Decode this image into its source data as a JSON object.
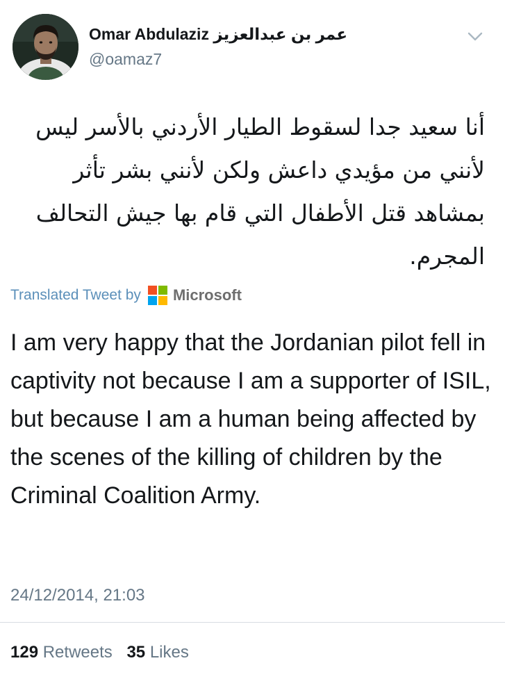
{
  "user": {
    "display_name": "Omar Abdulaziz عمر بن عبدالعزيز",
    "handle": "@oamaz7"
  },
  "icons": {
    "menu": "chevron-down-icon",
    "avatar": "profile-avatar",
    "translator_logo": "microsoft-logo"
  },
  "tweet": {
    "arabic_text": "أنا سعيد جدا لسقوط الطيار الأردني بالأسر ليس لأنني من مؤيدي داعش ولكن لأنني بشر تأثر بمشاهد قتل الأطفال التي قام بها جيش التحالف المجرم.",
    "translated_by_label": "Translated Tweet by",
    "translator_name": "Microsoft",
    "translation": "I am very happy that the Jordanian pilot fell in captivity not because I am a supporter of ISIL, but because I am a human being affected by the scenes of the killing of children by the Criminal Coalition Army.",
    "timestamp": "24/12/2014, 21:03"
  },
  "stats": {
    "retweets_count": "129",
    "retweets_label": "Retweets",
    "likes_count": "35",
    "likes_label": "Likes"
  },
  "colors": {
    "text": "#14171a",
    "secondary": "#657786",
    "link": "#5b8fb9",
    "ms_red": "#f25022",
    "ms_green": "#7fba00",
    "ms_blue": "#00a4ef",
    "ms_yellow": "#ffb900"
  }
}
